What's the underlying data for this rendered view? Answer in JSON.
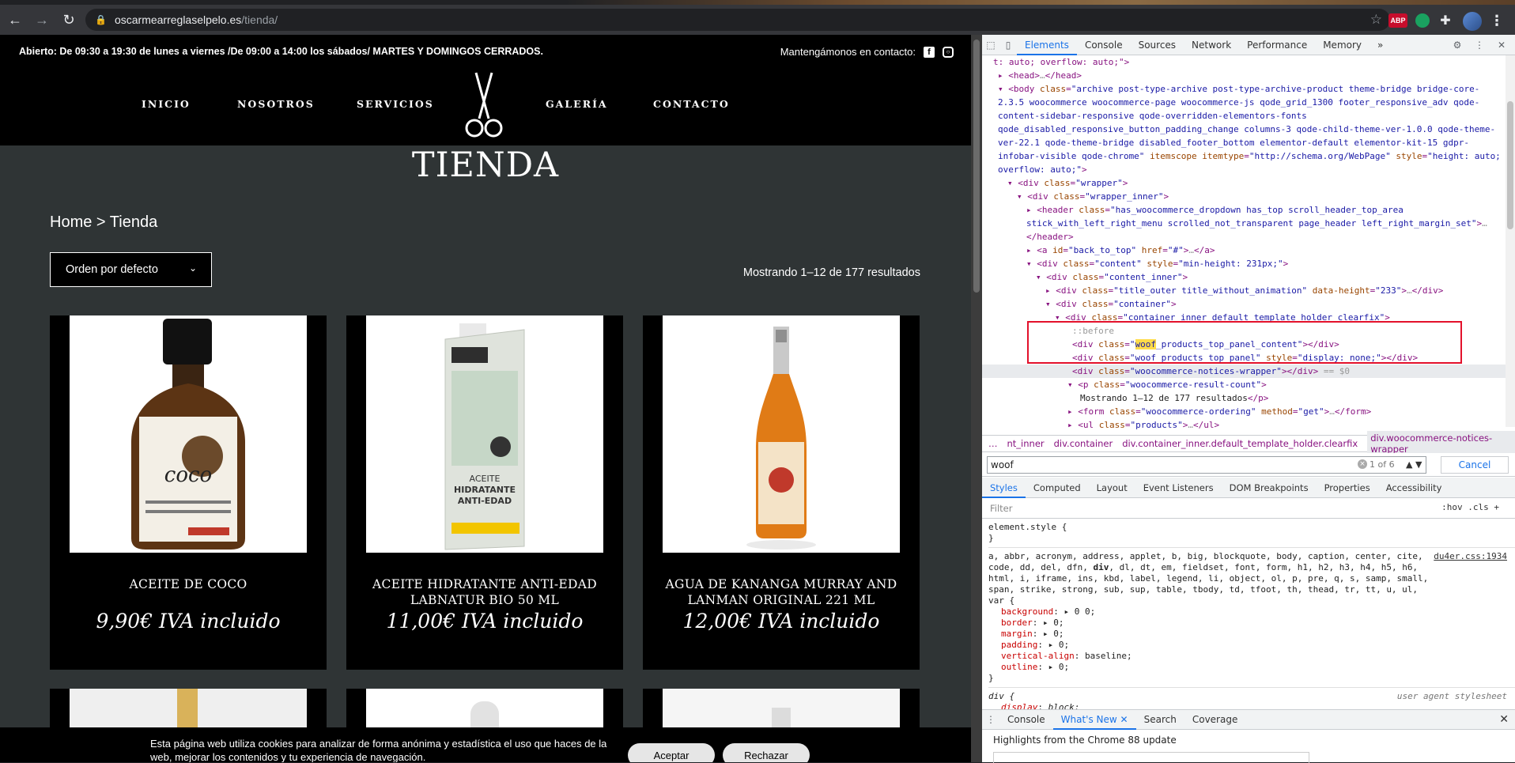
{
  "browser": {
    "url_host": "oscarmearreglaselpelo.es",
    "url_path": "/tienda/",
    "ext_abp": "ABP"
  },
  "site": {
    "hours": "Abierto: De 09:30 a 19:30 de lunes a viernes  /De 09:00 a 14:00 los sábados/ MARTES Y DOMINGOS CERRADOS.",
    "contact": "Mantengámonos en contacto:",
    "nav": [
      "INICIO",
      "NOSOTROS",
      "SERVICIOS",
      "GALERÍA",
      "CONTACTO"
    ],
    "title": "TIENDA",
    "breadcrumb": "Home > Tienda",
    "sort": "Orden por defecto",
    "result_count": "Mostrando 1–12 de 177 resultados",
    "products": [
      {
        "name": "ACEITE DE COCO",
        "price": "9,90€ IVA incluido"
      },
      {
        "name": "ACEITE HIDRATANTE ANTI-EDAD LABNATUR BIO 50 ML",
        "price": "11,00€ IVA incluido"
      },
      {
        "name": "AGUA DE KANANGA MURRAY AND LANMAN ORIGINAL 221 ML",
        "price": "12,00€ IVA incluido"
      }
    ],
    "cookie_text": "Esta página web utiliza cookies para analizar de forma anónima y estadística el uso que haces de la web, mejorar los contenidos y tu experiencia de navegación.",
    "cookie_accept": "Aceptar",
    "cookie_reject": "Rechazar"
  },
  "devtools": {
    "tabs": [
      "Elements",
      "Console",
      "Sources",
      "Network",
      "Performance",
      "Memory"
    ],
    "more": "»",
    "crumbs": [
      "nt_inner",
      "div.container",
      "div.container_inner.default_template_holder.clearfix",
      "div.woocommerce-notices-wrapper"
    ],
    "crumbs_more": "…",
    "search_value": "woof",
    "search_count": "1 of 6",
    "search_cancel": "Cancel",
    "styles_tabs": [
      "Styles",
      "Computed",
      "Layout",
      "Event Listeners",
      "DOM Breakpoints",
      "Properties",
      "Accessibility"
    ],
    "filter_placeholder": "Filter",
    "filter_tools": ":hov  .cls  +",
    "drawer_tabs": [
      "Console",
      "What's New",
      "Search",
      "Coverage"
    ],
    "drawer_text": "Highlights from the Chrome 88 update",
    "css_src": "du4er.css:1934",
    "ua_src": "user agent stylesheet"
  },
  "colors": {
    "site_bg": "#2f3435",
    "header_bg": "#000000",
    "highlight_box": "#e3112b",
    "search_mark": "#ffdc4a"
  }
}
